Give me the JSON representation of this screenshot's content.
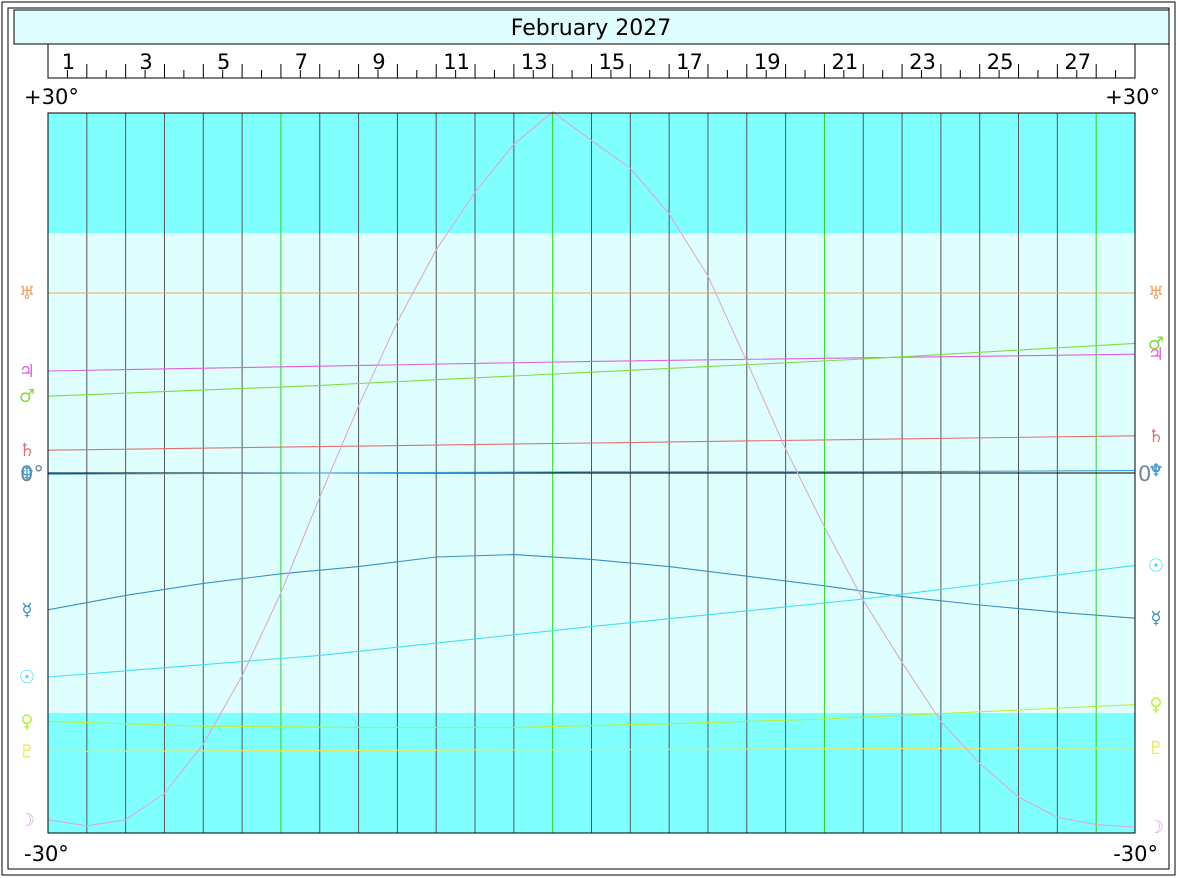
{
  "chart_data": {
    "type": "line",
    "title": "February 2027",
    "x_label_days": [
      "1",
      "3",
      "5",
      "7",
      "9",
      "11",
      "13",
      "15",
      "17",
      "19",
      "21",
      "23",
      "25",
      "27"
    ],
    "top_left_label": "+30°",
    "top_right_label": "+30°",
    "bottom_left_label": "-30°",
    "bottom_right_label": "-30°",
    "zero_left_label": "0°",
    "zero_right_label": "0°",
    "ylim": [
      -30,
      30
    ],
    "xlim": [
      1,
      29
    ],
    "band_upper_start": 20,
    "band_lower_end": -20,
    "colors": {
      "background": "#dfffff",
      "band": "#80ffff",
      "grid": "#555555",
      "grid_week": "#33cc33"
    },
    "week_marker_days": [
      7,
      14,
      21,
      28
    ],
    "series": [
      {
        "name": "Uranus",
        "glyph": "♅",
        "color": "#f0a060",
        "x": [
          1,
          29
        ],
        "y": [
          15,
          15
        ]
      },
      {
        "name": "Jupiter",
        "glyph": "♃",
        "color": "#e060e0",
        "x": [
          1,
          8,
          15,
          22,
          29
        ],
        "y": [
          8.5,
          8.9,
          9.3,
          9.6,
          9.9
        ]
      },
      {
        "name": "Mars",
        "glyph": "♂",
        "color": "#80dd40",
        "x": [
          1,
          8,
          15,
          22,
          29
        ],
        "y": [
          6.4,
          7.3,
          8.4,
          9.5,
          10.8
        ]
      },
      {
        "name": "Saturn",
        "glyph": "♄",
        "color": "#e07070",
        "x": [
          1,
          8,
          15,
          22,
          29
        ],
        "y": [
          1.9,
          2.2,
          2.5,
          2.8,
          3.1
        ]
      },
      {
        "name": "Neptune",
        "glyph": "♆",
        "color": "#3a9ad8",
        "x": [
          1,
          8,
          15,
          22,
          29
        ],
        "y": [
          -0.1,
          0.0,
          0.1,
          0.1,
          0.2
        ]
      },
      {
        "name": "Mercury",
        "glyph": "☿",
        "color": "#3a8fbf",
        "x": [
          1,
          3,
          5,
          7,
          9,
          11,
          13,
          15,
          17,
          19,
          21,
          23,
          25,
          27,
          29
        ],
        "y": [
          -11.4,
          -10.2,
          -9.2,
          -8.4,
          -7.8,
          -7.0,
          -6.8,
          -7.2,
          -7.8,
          -8.6,
          -9.4,
          -10.3,
          -11.0,
          -11.6,
          -12.1
        ]
      },
      {
        "name": "Sun",
        "glyph": "☉",
        "color": "#40e0f0",
        "x": [
          1,
          8,
          15,
          22,
          29
        ],
        "y": [
          -17.0,
          -15.2,
          -12.8,
          -10.5,
          -7.7
        ]
      },
      {
        "name": "Venus",
        "glyph": "♀",
        "color": "#b8f040",
        "x": [
          1,
          5,
          9,
          13,
          17,
          21,
          25,
          29
        ],
        "y": [
          -20.7,
          -21.1,
          -21.2,
          -21.2,
          -20.9,
          -20.5,
          -19.9,
          -19.3
        ]
      },
      {
        "name": "Pluto",
        "glyph": "♇",
        "color": "#e8e860",
        "x": [
          1,
          29
        ],
        "y": [
          -23.2,
          -22.9
        ]
      },
      {
        "name": "Moon",
        "glyph": "☽",
        "color": "#d8a8e0",
        "x": [
          1,
          2,
          3,
          4,
          5,
          6,
          7,
          8,
          9,
          10,
          11,
          12,
          13,
          14,
          15,
          16,
          17,
          18,
          19,
          20,
          21,
          22,
          23,
          24,
          25,
          26,
          27,
          28,
          29
        ],
        "y": [
          -28.9,
          -29.4,
          -28.9,
          -26.7,
          -22.6,
          -16.9,
          -10.0,
          -2.0,
          5.6,
          12.6,
          18.6,
          23.4,
          27.4,
          30.1,
          27.7,
          25.4,
          21.6,
          16.4,
          9.3,
          2.0,
          -4.5,
          -10.6,
          -15.8,
          -20.7,
          -24.2,
          -27.0,
          -28.7,
          -29.3,
          -29.5
        ]
      }
    ]
  }
}
